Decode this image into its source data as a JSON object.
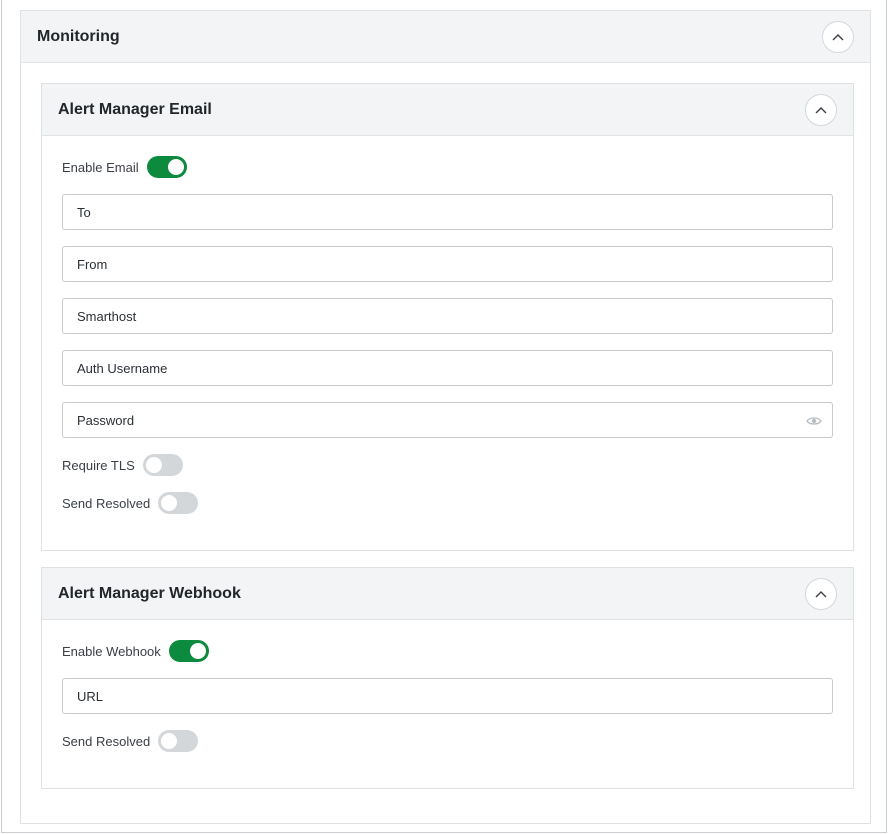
{
  "monitoring": {
    "title": "Monitoring"
  },
  "email_section": {
    "title": "Alert Manager Email",
    "enable_label": "Enable Email",
    "enable_on": true,
    "fields": {
      "to": "To",
      "from": "From",
      "smarthost": "Smarthost",
      "auth_username": "Auth Username",
      "password": "Password"
    },
    "require_tls_label": "Require TLS",
    "require_tls_on": false,
    "send_resolved_label": "Send Resolved",
    "send_resolved_on": false
  },
  "webhook_section": {
    "title": "Alert Manager Webhook",
    "enable_label": "Enable Webhook",
    "enable_on": true,
    "fields": {
      "url": "URL"
    },
    "send_resolved_label": "Send Resolved",
    "send_resolved_on": false
  },
  "colors": {
    "toggle_on": "#0c8a3e",
    "toggle_off": "#d4d7da",
    "header_bg": "#f3f4f5"
  },
  "icons": {
    "collapse": "chevron-up-icon",
    "password_visibility": "eye-icon"
  }
}
